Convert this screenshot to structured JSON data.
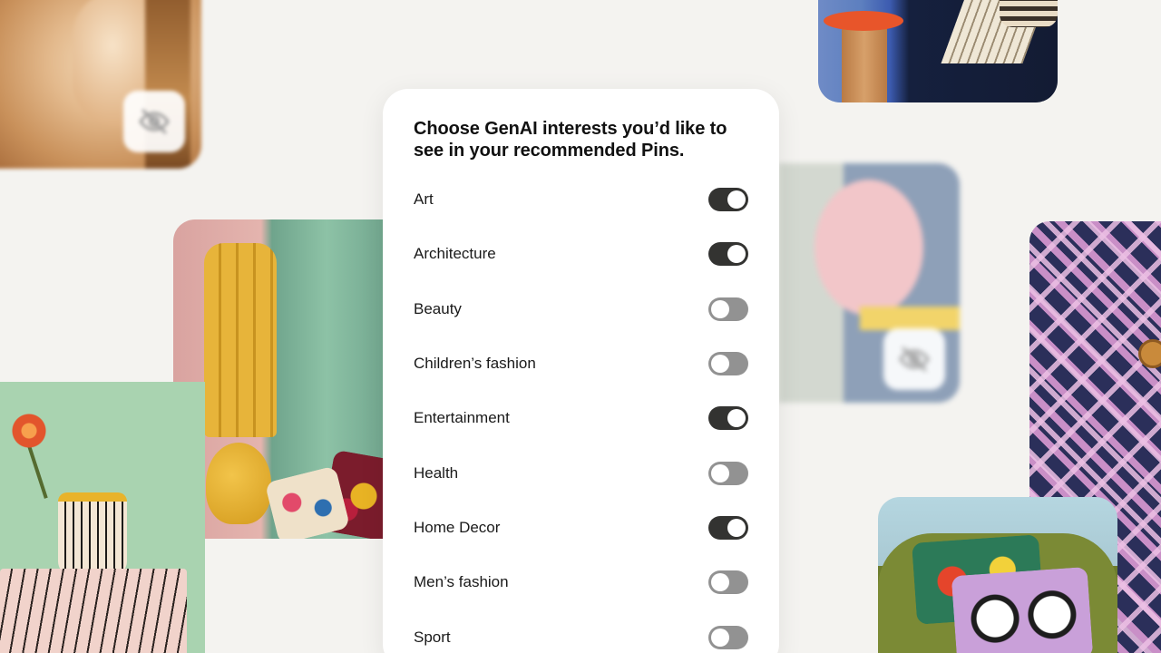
{
  "dialog": {
    "title": "Choose GenAI interests you’d like to see in your recommended Pins."
  },
  "interests": [
    {
      "label": "Art",
      "enabled": true
    },
    {
      "label": "Architecture",
      "enabled": true
    },
    {
      "label": "Beauty",
      "enabled": false
    },
    {
      "label": "Children’s fashion",
      "enabled": false
    },
    {
      "label": "Entertainment",
      "enabled": true
    },
    {
      "label": "Health",
      "enabled": false
    },
    {
      "label": "Home Decor",
      "enabled": true
    },
    {
      "label": "Men’s fashion",
      "enabled": false
    },
    {
      "label": "Sport",
      "enabled": false
    }
  ],
  "background_tiles": [
    {
      "name": "portrait-photo",
      "hidden": true,
      "icon": "eye-off-icon"
    },
    {
      "name": "side-table-and-sofa-photo",
      "hidden": false
    },
    {
      "name": "yellow-lamp-photo",
      "hidden": false
    },
    {
      "name": "striped-vase-photo",
      "hidden": false
    },
    {
      "name": "pickleball-paddle-photo",
      "hidden": true,
      "icon": "eye-off-icon"
    },
    {
      "name": "plaid-jacket-photo",
      "hidden": false
    },
    {
      "name": "floral-cushions-sofa-photo",
      "hidden": false
    }
  ],
  "colors": {
    "page_background": "#f4f3f0",
    "toggle_on": "#333331",
    "toggle_off": "#929292",
    "card_background": "#ffffff"
  }
}
